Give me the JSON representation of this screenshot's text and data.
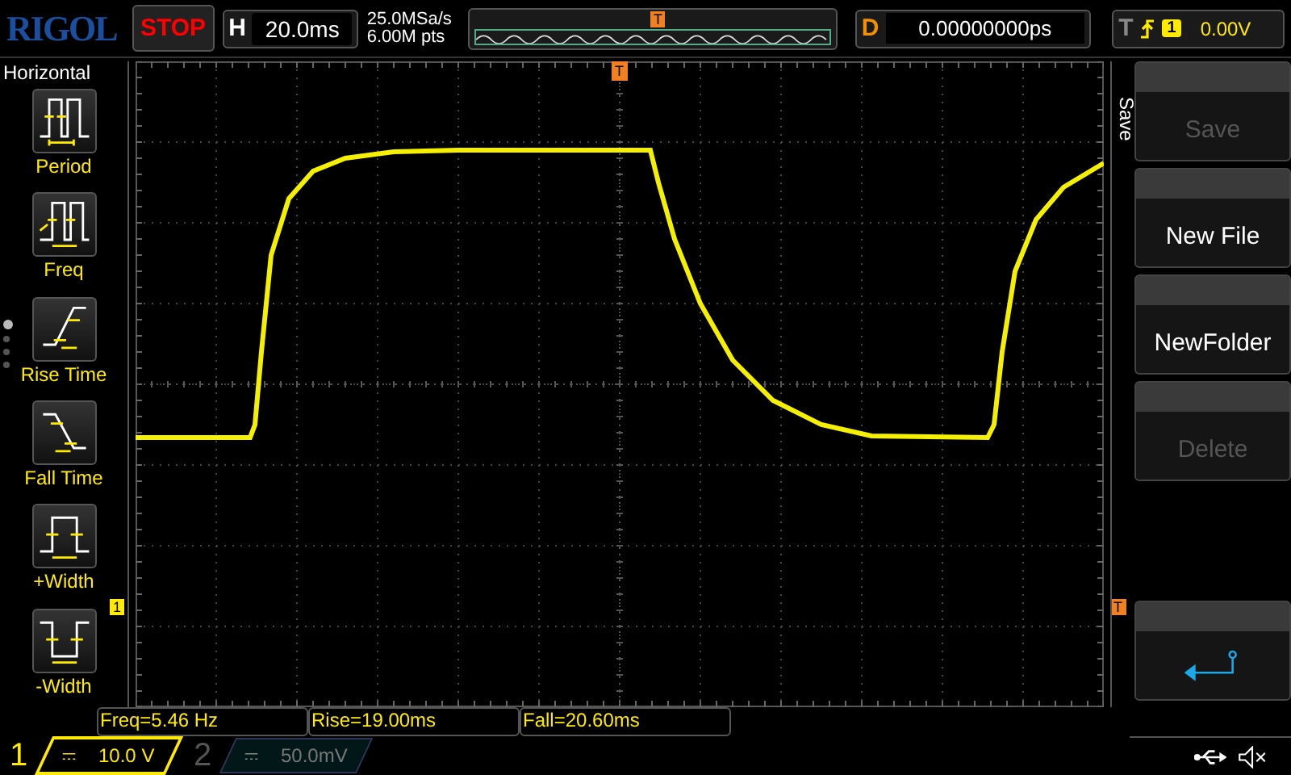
{
  "header": {
    "logo": "RIGOL",
    "run_state": "STOP",
    "timebase": {
      "label": "H",
      "value": "20.0ms"
    },
    "sample_rate": "25.0MSa/s",
    "memory_depth": "6.00M pts",
    "trigger_marker": "T",
    "delay": {
      "label": "D",
      "value": "0.00000000ps"
    },
    "trigger": {
      "label": "T",
      "source": "1",
      "level": "0.00V"
    }
  },
  "measure_menu": {
    "title": "Horizontal",
    "items": [
      {
        "label": "Period",
        "kind": "period"
      },
      {
        "label": "Freq",
        "kind": "freq"
      },
      {
        "label": "Rise Time",
        "kind": "rise"
      },
      {
        "label": "Fall Time",
        "kind": "fall"
      },
      {
        "label": "+Width",
        "kind": "pwidth"
      },
      {
        "label": "-Width",
        "kind": "nwidth"
      }
    ],
    "page_dots": [
      {
        "selected": true
      },
      {
        "selected": false
      },
      {
        "selected": false
      },
      {
        "selected": false
      }
    ]
  },
  "screen": {
    "trigger_position_marker": "T",
    "channel_marker": "1",
    "trigger_level_marker": "T"
  },
  "softkeys": {
    "title": "Save",
    "buttons": [
      {
        "kind": "text",
        "label": "Save",
        "disabled": true
      },
      {
        "kind": "text",
        "label": "New File",
        "disabled": false
      },
      {
        "kind": "text",
        "label": "NewFolder",
        "disabled": false
      },
      {
        "kind": "text",
        "label": "Delete",
        "disabled": true
      },
      {
        "kind": "back"
      }
    ]
  },
  "measurements": [
    "Freq=5.46 Hz",
    "Rise=19.00ms",
    "Fall=20.60ms"
  ],
  "channels": [
    {
      "number": "1",
      "scale": "10.0 V",
      "on": true
    },
    {
      "number": "2",
      "scale": "50.0mV",
      "on": false
    }
  ]
}
